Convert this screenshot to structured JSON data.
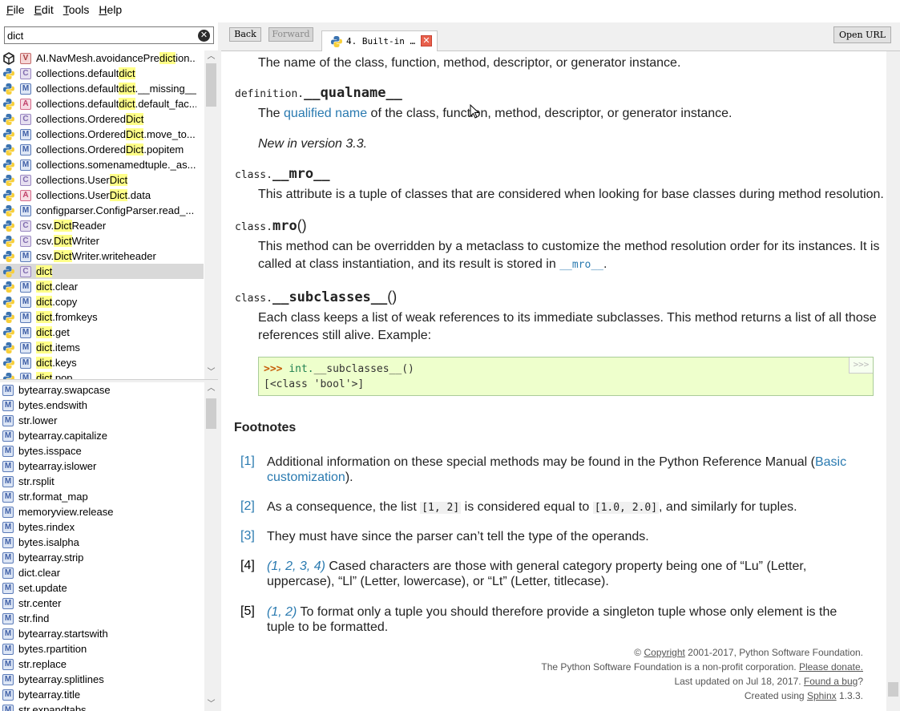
{
  "menubar": {
    "items": [
      "File",
      "Edit",
      "Tools",
      "Help"
    ]
  },
  "search": {
    "value": "dict"
  },
  "results_top": [
    {
      "kind": "V",
      "icon": "unity-icon",
      "pre": "AI.NavMesh.avoidancePre",
      "hl": "dict",
      "post": "ion..."
    },
    {
      "kind": "C",
      "icon": "python-icon",
      "pre": "collections.default",
      "hl": "dict",
      "post": ""
    },
    {
      "kind": "M",
      "icon": "python-icon",
      "pre": "collections.default",
      "hl": "dict",
      "post": ".__missing__"
    },
    {
      "kind": "A",
      "icon": "python-icon",
      "pre": "collections.default",
      "hl": "dict",
      "post": ".default_fac..."
    },
    {
      "kind": "C",
      "icon": "python-icon",
      "pre": "collections.Ordered",
      "hl": "Dict",
      "post": ""
    },
    {
      "kind": "M",
      "icon": "python-icon",
      "pre": "collections.Ordered",
      "hl": "Dict",
      "post": ".move_to..."
    },
    {
      "kind": "M",
      "icon": "python-icon",
      "pre": "collections.Ordered",
      "hl": "Dict",
      "post": ".popitem"
    },
    {
      "kind": "M",
      "icon": "python-icon",
      "pre": "collections.somenamedtuple._as...",
      "hl": "",
      "post": ""
    },
    {
      "kind": "C",
      "icon": "python-icon",
      "pre": "collections.User",
      "hl": "Dict",
      "post": ""
    },
    {
      "kind": "A",
      "icon": "python-icon",
      "pre": "collections.User",
      "hl": "Dict",
      "post": ".data"
    },
    {
      "kind": "M",
      "icon": "python-icon",
      "pre": "configparser.ConfigParser.read_...",
      "hl": "",
      "post": ""
    },
    {
      "kind": "C",
      "icon": "python-icon",
      "pre": "csv.",
      "hl": "Dict",
      "post": "Reader"
    },
    {
      "kind": "C",
      "icon": "python-icon",
      "pre": "csv.",
      "hl": "Dict",
      "post": "Writer"
    },
    {
      "kind": "M",
      "icon": "python-icon",
      "pre": "csv.",
      "hl": "Dict",
      "post": "Writer.writeheader"
    },
    {
      "kind": "C",
      "icon": "python-icon",
      "pre": "",
      "hl": "dict",
      "post": "",
      "selected": true
    },
    {
      "kind": "M",
      "icon": "python-icon",
      "pre": "",
      "hl": "dict",
      "post": ".clear"
    },
    {
      "kind": "M",
      "icon": "python-icon",
      "pre": "",
      "hl": "dict",
      "post": ".copy"
    },
    {
      "kind": "M",
      "icon": "python-icon",
      "pre": "",
      "hl": "dict",
      "post": ".fromkeys"
    },
    {
      "kind": "M",
      "icon": "python-icon",
      "pre": "",
      "hl": "dict",
      "post": ".get"
    },
    {
      "kind": "M",
      "icon": "python-icon",
      "pre": "",
      "hl": "dict",
      "post": ".items"
    },
    {
      "kind": "M",
      "icon": "python-icon",
      "pre": "",
      "hl": "dict",
      "post": ".keys"
    },
    {
      "kind": "M",
      "icon": "python-icon",
      "pre": "",
      "hl": "dict",
      "post": ".pop"
    }
  ],
  "results_bottom": [
    "bytearray.swapcase",
    "bytes.endswith",
    "str.lower",
    "bytearray.capitalize",
    "bytes.isspace",
    "bytearray.islower",
    "str.rsplit",
    "str.format_map",
    "memoryview.release",
    "bytes.rindex",
    "bytes.isalpha",
    "bytearray.strip",
    "dict.clear",
    "set.update",
    "str.center",
    "str.find",
    "bytearray.startswith",
    "bytes.rpartition",
    "str.replace",
    "bytearray.splitlines",
    "bytearray.title",
    "str.expandtabs"
  ],
  "toolbar": {
    "back": "Back",
    "forward": "Forward",
    "tab_title": "4. Built-in …",
    "open_url": "Open URL"
  },
  "doc": {
    "p_name_desc": "The name of the class, function, method, descriptor, or generator instance.",
    "qualname_prefix": "definition.",
    "qualname_name": "__qualname__",
    "qualname_desc_pre": "The ",
    "qualname_desc_link": "qualified name",
    "qualname_desc_post": " of the class, function, method, descriptor, or generator instance.",
    "new_in": "New in version 3.3.",
    "mro_attr_prefix": "class.",
    "mro_attr_name": "__mro__",
    "mro_attr_desc": "This attribute is a tuple of classes that are considered when looking for base classes during method resolution.",
    "mro_meth_prefix": "class.",
    "mro_meth_name": "mro",
    "mro_meth_paren": "()",
    "mro_meth_desc1": "This method can be overridden by a metaclass to customize the method resolution order for its instances. It is",
    "mro_meth_desc2_pre": "called at class instantiation, and its result is stored in ",
    "mro_meth_desc2_link": "__mro__",
    "mro_meth_desc2_post": ".",
    "subclasses_prefix": "class.",
    "subclasses_name": "__subclasses__",
    "subclasses_paren": "()",
    "subclasses_desc1": "Each class keeps a list of weak references to its immediate subclasses. This method returns a list of all those",
    "subclasses_desc2": "references still alive. Example:",
    "example_prompt": ">>>",
    "example_code": "int.",
    "example_fn": "__subclasses__()",
    "example_output": "[<class 'bool'>]",
    "copy_button": ">>>"
  },
  "footnotes": {
    "title": "Footnotes",
    "items": [
      {
        "num": "[1]",
        "pre": "Additional information on these special methods may be found in the Python Reference Manual (",
        "link": "Basic customization",
        "post": ")."
      },
      {
        "num": "[2]",
        "pre": "As a consequence, the list ",
        "code1": "[1, 2]",
        "mid": " is considered equal to ",
        "code2": "[1.0, 2.0]",
        "post": ", and similarly for tuples."
      },
      {
        "num": "[3]",
        "text": "They must have since the parser can’t tell the type of the operands."
      },
      {
        "num": "[4]",
        "refs": "(1, 2, 3, 4)",
        "text": " Cased characters are those with general category property being one of “Lu” (Letter, uppercase), “Ll” (Letter, lowercase), or “Lt” (Letter, titlecase)."
      },
      {
        "num": "[5]",
        "refs": "(1, 2)",
        "text": " To format only a tuple you should therefore provide a singleton tuple whose only element is the tuple to be formatted."
      }
    ]
  },
  "footer": {
    "line1_pre": "© ",
    "line1_link": "Copyright",
    "line1_post": " 2001-2017, Python Software Foundation.",
    "line2_pre": "The Python Software Foundation is a non-profit corporation. ",
    "line2_link": "Please donate.",
    "line3_pre": "Last updated on Jul 18, 2017. ",
    "line3_link": "Found a bug",
    "line3_post": "?",
    "line4_pre": "Created using ",
    "line4_link": "Sphinx",
    "line4_post": " 1.3.3."
  },
  "colors": {
    "highlight": "#ffff88",
    "link": "#2a7ab0",
    "selected_row": "#d9d9d9",
    "example_bg": "#eeffcc"
  }
}
